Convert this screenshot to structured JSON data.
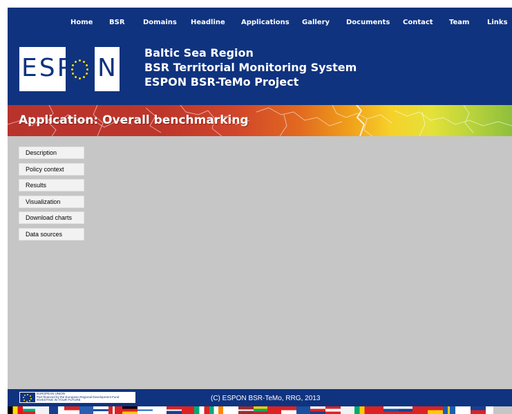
{
  "nav": {
    "items": [
      "Home",
      "BSR",
      "Domains",
      "Headline",
      "Applications",
      "Gallery",
      "Documents",
      "Contact",
      "Team",
      "Links"
    ]
  },
  "logo": {
    "letters": "ESP",
    "n": "N"
  },
  "header": {
    "title_line1": "Baltic Sea Region",
    "title_line2": "BSR Territorial Monitoring System",
    "title_line3": "ESPON BSR-TeMo Project"
  },
  "banner": {
    "title": "Application: Overall benchmarking"
  },
  "sidebar": {
    "items": [
      "Description",
      "Policy context",
      "Results",
      "Visualization",
      "Download charts",
      "Data sources"
    ]
  },
  "footer": {
    "eu_line1": "EUROPEAN UNION",
    "eu_line2": "Part-financed by the European Regional Development Fund",
    "eu_line3": "INVESTING IN YOUR FUTURE",
    "copyright": "(C) ESPON BSR-TeMo, RRG, 2013"
  },
  "colors": {
    "header_blue": "#10337f",
    "content_gray": "#c6c6c6",
    "banner_red": "#bd362b",
    "banner_green": "#8ebf3d"
  }
}
